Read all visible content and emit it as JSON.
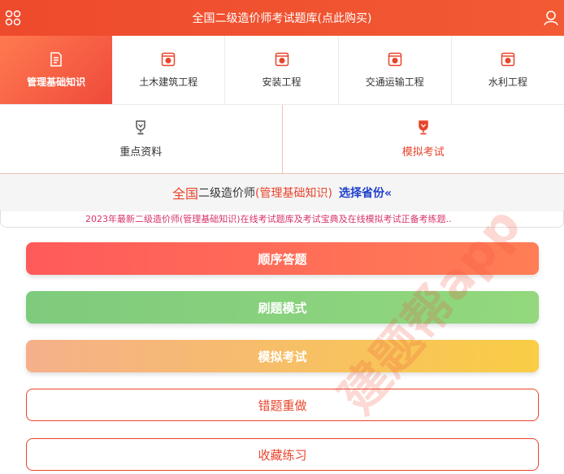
{
  "header": {
    "title": "全国二级造价师考试题库(点此购买)",
    "menu_icon": "grid-icon",
    "user_icon": "user-icon"
  },
  "categories": [
    {
      "label": "管理基础知识",
      "icon": "document-icon",
      "active": true
    },
    {
      "label": "土木建筑工程",
      "icon": "book-icon",
      "active": false
    },
    {
      "label": "安装工程",
      "icon": "book-icon",
      "active": false
    },
    {
      "label": "交通运输工程",
      "icon": "book-icon",
      "active": false
    },
    {
      "label": "水利工程",
      "icon": "book-icon",
      "active": false
    }
  ],
  "tabs": [
    {
      "label": "重点资料",
      "icon": "trophy-icon",
      "active": false
    },
    {
      "label": "模拟考试",
      "icon": "trophy-icon",
      "active": true
    }
  ],
  "subject_bar": {
    "prefix": "全国",
    "exam": "二级造价师",
    "subject": "(管理基础知识)",
    "select_province": "选择省份«"
  },
  "notice": "2023年最新二级造价师(管理基础知识)在线考试题库及考试宝典及在线模拟考试正备考练题..",
  "actions": {
    "sequential": "顺序答题",
    "practice": "刷题模式",
    "mock_exam": "模拟考试",
    "wrong_redo": "错题重做",
    "favorites": "收藏练习"
  },
  "watermark": "建题帮app",
  "colors": {
    "brand_red": "#e8452c",
    "green": "#7ecb7d",
    "orange": "#f9cd45",
    "link_blue": "#1f3fcc",
    "notice_pink": "#d6336c"
  }
}
